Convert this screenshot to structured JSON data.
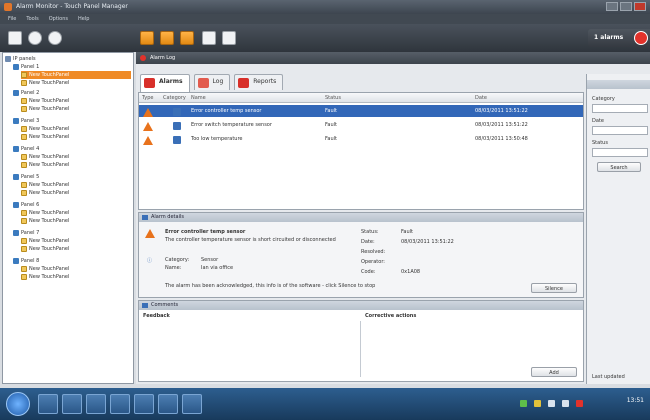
{
  "window": {
    "title": "Alarm Monitor - Touch Panel Manager",
    "menu": [
      "File",
      "Tools",
      "Options",
      "Help"
    ]
  },
  "toolbar": {
    "alarm_badge": "1 alarms"
  },
  "tree": {
    "root": "IP panels",
    "groups": [
      {
        "label": "Panel 1",
        "items": [
          "New TouchPanel",
          "New TouchPanel"
        ]
      },
      {
        "label": "Panel 2",
        "items": [
          "New TouchPanel",
          "New TouchPanel"
        ]
      },
      {
        "label": "Panel 3",
        "items": [
          "New TouchPanel",
          "New TouchPanel"
        ]
      },
      {
        "label": "Panel 4",
        "items": [
          "New TouchPanel",
          "New TouchPanel"
        ]
      },
      {
        "label": "Panel 5",
        "items": [
          "New TouchPanel",
          "New TouchPanel"
        ]
      },
      {
        "label": "Panel 6",
        "items": [
          "New TouchPanel",
          "New TouchPanel"
        ]
      },
      {
        "label": "Panel 7",
        "items": [
          "New TouchPanel",
          "New TouchPanel"
        ]
      },
      {
        "label": "Panel 8",
        "items": [
          "New TouchPanel",
          "New TouchPanel"
        ]
      }
    ]
  },
  "main": {
    "header": "Alarm Log",
    "tabs": [
      "Alarms",
      "Log",
      "Reports"
    ],
    "columns": [
      "Type",
      "Category",
      "Name",
      "Status",
      "Date"
    ],
    "rows": [
      {
        "name": "Error controller temp sensor",
        "status": "Fault",
        "date": "08/03/2011 13:51:22"
      },
      {
        "name": "Error switch temperature sensor",
        "status": "Fault",
        "date": "08/03/2011 13:51:22"
      },
      {
        "name": "Too low temperature",
        "status": "Fault",
        "date": "08/03/2011 13:50:48"
      }
    ]
  },
  "detail": {
    "header": "Alarm details",
    "title": "Error controller temp sensor",
    "description": "The controller temperature sensor is short circuited or disconnected",
    "category_label": "Category:",
    "category": "Sensor",
    "panel_label": "Name:",
    "panel": "Ian via office",
    "status_label": "Status:",
    "status": "Fault",
    "date_label": "Date:",
    "date": "08/03/2011 13:51:22",
    "resolved_label": "Resolved:",
    "operator_label": "Operator:",
    "code_label": "Code:",
    "code": "0x1A08",
    "note": "The alarm has been acknowledged, this info is of the software - click Silence to stop",
    "silence_button": "Silence"
  },
  "bottom": {
    "header": "Comments",
    "left_col": "Feedback",
    "right_col": "Corrective actions",
    "save_button": "Add"
  },
  "side": {
    "field1": "Category",
    "field2": "Date",
    "field3": "Status",
    "filter_button": "Search",
    "footer": "Last updated"
  },
  "taskbar": {
    "clock": "13:51"
  }
}
